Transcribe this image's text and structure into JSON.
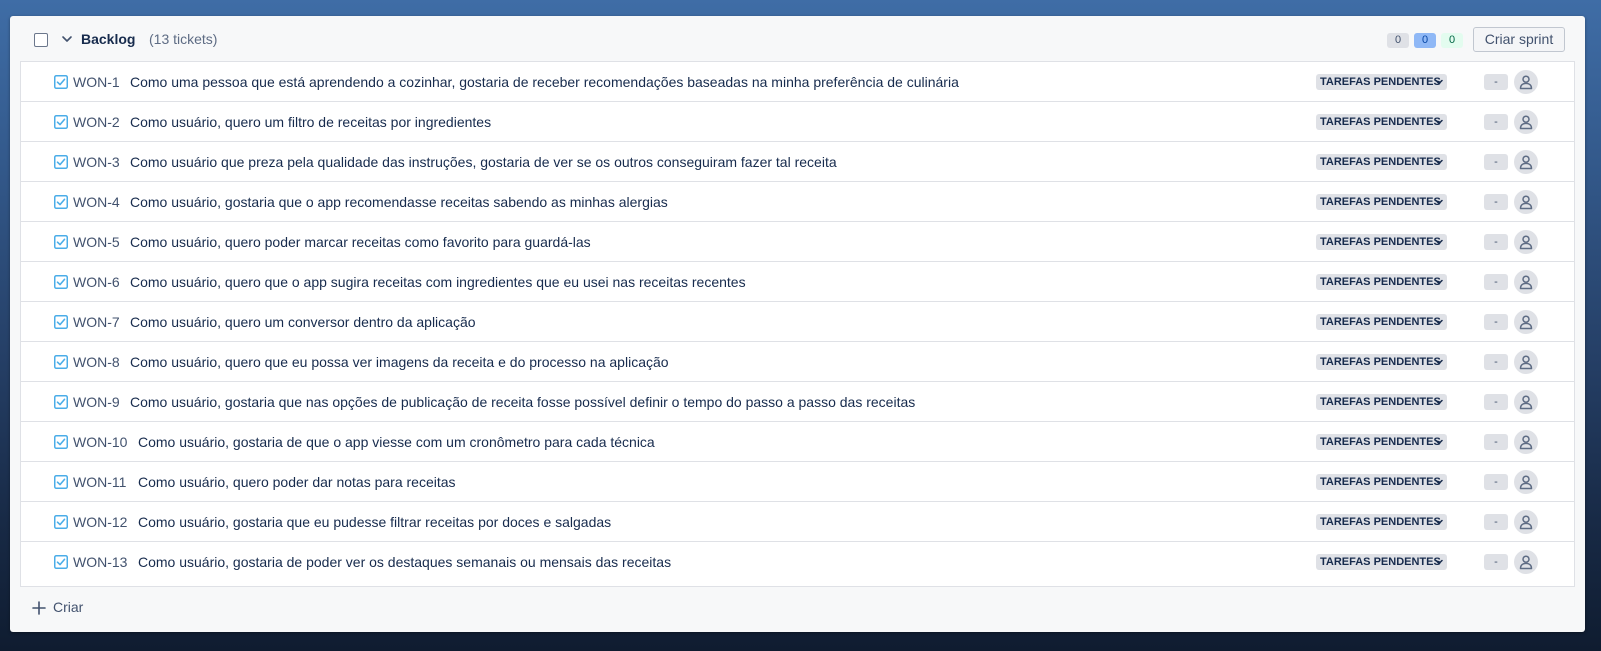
{
  "backlog": {
    "title": "Backlog",
    "count": "(13 tickets)",
    "counters": {
      "todo": "0",
      "in_progress": "0",
      "done": "0"
    },
    "create_sprint_label": "Criar sprint"
  },
  "issues": [
    {
      "key": "WON-1",
      "summary": "Como uma pessoa que está aprendendo a cozinhar, gostaria de receber recomendações baseadas na minha preferência de culinária",
      "status": "TAREFAS PENDENTES",
      "estimate": "-"
    },
    {
      "key": "WON-2",
      "summary": "Como usuário, quero um filtro de receitas por ingredientes",
      "status": "TAREFAS PENDENTES",
      "estimate": "-"
    },
    {
      "key": "WON-3",
      "summary": "Como usuário que preza pela qualidade das instruções, gostaria de ver se os outros conseguiram fazer tal receita",
      "status": "TAREFAS PENDENTES",
      "estimate": "-"
    },
    {
      "key": "WON-4",
      "summary": "Como usuário, gostaria que o app recomendasse receitas sabendo as minhas alergias",
      "status": "TAREFAS PENDENTES",
      "estimate": "-"
    },
    {
      "key": "WON-5",
      "summary": "Como usuário, quero poder marcar receitas como favorito para guardá-las",
      "status": "TAREFAS PENDENTES",
      "estimate": "-"
    },
    {
      "key": "WON-6",
      "summary": "Como usuário, quero que o app sugira receitas com ingredientes que eu usei nas receitas recentes",
      "status": "TAREFAS PENDENTES",
      "estimate": "-"
    },
    {
      "key": "WON-7",
      "summary": "Como usuário, quero um conversor dentro da aplicação",
      "status": "TAREFAS PENDENTES",
      "estimate": "-"
    },
    {
      "key": "WON-8",
      "summary": "Como usuário, quero que eu possa ver imagens da receita e do processo na aplicação",
      "status": "TAREFAS PENDENTES",
      "estimate": "-"
    },
    {
      "key": "WON-9",
      "summary": "Como usuário, gostaria que nas opções de publicação de receita fosse possível definir o tempo do passo a passo das receitas",
      "status": "TAREFAS PENDENTES",
      "estimate": "-"
    },
    {
      "key": "WON-10",
      "summary": "Como usuário, gostaria de que o app viesse com um cronômetro para cada técnica",
      "status": "TAREFAS PENDENTES",
      "estimate": "-"
    },
    {
      "key": "WON-11",
      "summary": "Como usuário, quero poder dar notas para receitas",
      "status": "TAREFAS PENDENTES",
      "estimate": "-"
    },
    {
      "key": "WON-12",
      "summary": "Como usuário, gostaria que eu pudesse filtrar receitas por doces e salgadas",
      "status": "TAREFAS PENDENTES",
      "estimate": "-"
    },
    {
      "key": "WON-13",
      "summary": "Como usuário, gostaria de poder ver os destaques semanais ou mensais das receitas",
      "status": "TAREFAS PENDENTES",
      "estimate": "-"
    }
  ],
  "create_label": "Criar",
  "colors": {
    "task_icon": "#4bade8",
    "accent_counter_in_progress": "#8fb8f6",
    "accent_counter_done": "#e3fcef"
  },
  "icons": {
    "task": "task-checkbox-icon",
    "avatar": "unassigned-user-icon",
    "create": "plus-icon",
    "collapse": "chevron-down-icon"
  }
}
